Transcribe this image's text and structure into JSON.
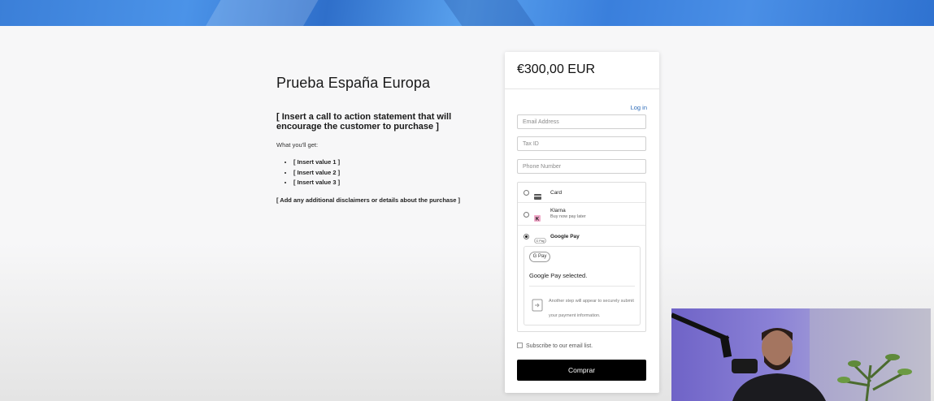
{
  "product": {
    "title": "Prueba España Europa",
    "cta": "[ Insert a call to action statement that will encourage the customer to purchase ]",
    "what_you_get": "What you'll get:",
    "values": [
      "[ Insert value 1 ]",
      "[ Insert value 2 ]",
      "[ Insert value 3 ]"
    ],
    "disclaimer": "[ Add any additional disclaimers or details about the purchase ]"
  },
  "checkout": {
    "price": "€300,00 EUR",
    "login_label": "Log in",
    "email_placeholder": "Email Address",
    "taxid_placeholder": "Tax ID",
    "phone_placeholder": "Phone Number",
    "methods": {
      "card": "Card",
      "klarna": "Klarna",
      "klarna_sub": "Buy now pay later",
      "gpay": "Google Pay",
      "gpay_badge": "G Pay",
      "gpay_selected": "Google Pay selected.",
      "gpay_step": "Another step will appear to securely submit your payment information."
    },
    "subscribe_label": "Subscribe to our email list.",
    "buy_label": "Comprar"
  },
  "colors": {
    "banner": "#3b7fd8",
    "link": "#2d6bb8",
    "buy_button": "#000000",
    "klarna": "#f0a8c8"
  }
}
